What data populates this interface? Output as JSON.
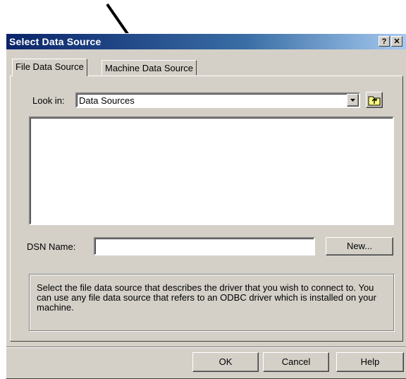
{
  "window": {
    "title": "Select Data Source",
    "help_glyph": "?",
    "close_glyph": "✕"
  },
  "tabs": [
    {
      "label": "File Data Source",
      "active": true
    },
    {
      "label": "Machine Data Source",
      "active": false
    }
  ],
  "look_in": {
    "label": "Look in:",
    "value": "Data Sources",
    "dropdown_icon": "chevron-down-icon",
    "up_folder_icon": "up-one-level-folder-icon"
  },
  "file_list": {
    "items": []
  },
  "dsn": {
    "label": "DSN Name:",
    "value": "",
    "new_button": "New..."
  },
  "description": "Select the file data source that describes the driver that you wish to connect to. You can use any file data source that refers to an ODBC driver which is installed on your machine.",
  "buttons": {
    "ok": "OK",
    "cancel": "Cancel",
    "help": "Help"
  },
  "colors": {
    "dialog_face": "#d4d0c8",
    "titlebar_start": "#0a246a",
    "titlebar_end": "#a6caf0",
    "annotation_arrow": "#000000"
  }
}
